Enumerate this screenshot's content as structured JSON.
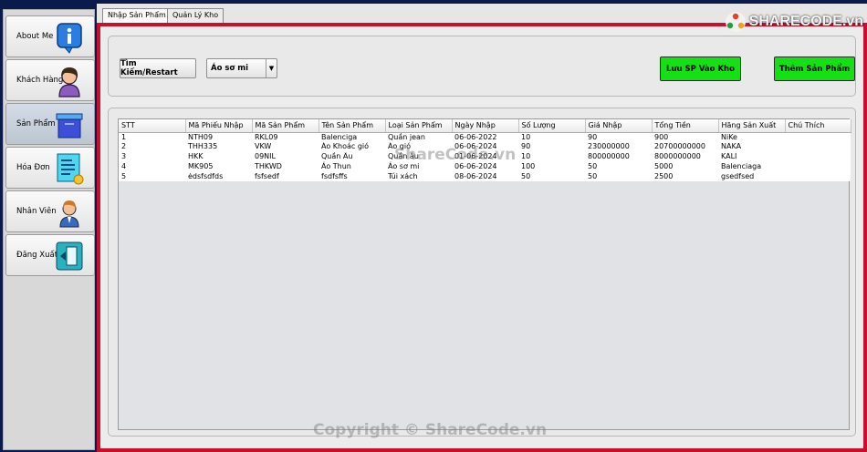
{
  "sidebar": {
    "items": [
      {
        "label": "About Me",
        "icon": "info-icon"
      },
      {
        "label": "Khách Hàng",
        "icon": "customer-avatar-icon"
      },
      {
        "label": "Sản Phẩm",
        "icon": "product-box-icon"
      },
      {
        "label": "Hóa Đơn",
        "icon": "invoice-icon"
      },
      {
        "label": "Nhân Viên",
        "icon": "employee-icon"
      },
      {
        "label": "Đăng Xuất",
        "icon": "logout-icon"
      }
    ]
  },
  "tabs": [
    "Nhập Sản Phẩm",
    "Quản Lý Kho"
  ],
  "toolbar": {
    "search_label": "Tìm Kiếm/Restart",
    "category_selected": "Áo sơ mi",
    "save_label": "Lưu SP Vào Kho",
    "add_label": "Thêm Sản Phẩm"
  },
  "table": {
    "columns": [
      "STT",
      "Mã Phiếu Nhập",
      "Mã Sản Phẩm",
      "Tên Sản Phẩm",
      "Loại Sản Phẩm",
      "Ngày Nhập",
      "Số Lượng",
      "Giá Nhập",
      "Tổng Tiền",
      "Hãng Sản Xuất",
      "Chú Thích"
    ],
    "rows": [
      [
        "1",
        "NTH09",
        "RKL09",
        "Balenciga",
        "Quần jean",
        "06-06-2022",
        "10",
        "90",
        "900",
        "NiKe",
        ""
      ],
      [
        "2",
        "THH335",
        "VKW",
        "Áo Khoác gió",
        "Áo gió",
        "06-06-2024",
        "90",
        "230000000",
        "20700000000",
        "NAKA",
        ""
      ],
      [
        "3",
        "HKK",
        "09NIL",
        "Quần Âu",
        "Quần âu",
        "01-06-2024",
        "10",
        "800000000",
        "8000000000",
        "KALI",
        ""
      ],
      [
        "4",
        "MK905",
        "THKWD",
        "Áo Thun",
        "Áo sơ mi",
        "06-06-2024",
        "100",
        "50",
        "5000",
        "Balenciaga",
        ""
      ],
      [
        "5",
        "ėdsfsdfds",
        "fsfsedf",
        "fsdfsffs",
        "Túi xách",
        "08-06-2024",
        "50",
        "50",
        "2500",
        "gsedfsed",
        ""
      ]
    ]
  },
  "watermarks": {
    "center": "ShareCode.vn",
    "footer": "Copyright © ShareCode.vn",
    "logo": "SHARECODE.vn"
  },
  "colors": {
    "frame_red": "#c8102e",
    "button_green": "#14e014",
    "background_navy": "#0a1a4a"
  }
}
